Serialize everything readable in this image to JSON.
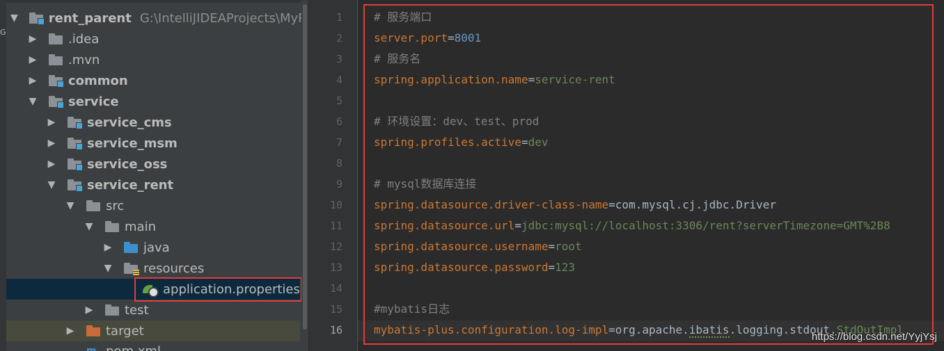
{
  "tree": {
    "strip_glyph": "G",
    "rows": [
      {
        "label": "rent_parent",
        "path": "G:\\IntelliJIDEAProjects\\MyProje"
      },
      {
        "label": ".idea"
      },
      {
        "label": ".mvn"
      },
      {
        "label": "common"
      },
      {
        "label": "service"
      },
      {
        "label": "service_cms"
      },
      {
        "label": "service_msm"
      },
      {
        "label": "service_oss"
      },
      {
        "label": "service_rent"
      },
      {
        "label": "src"
      },
      {
        "label": "main"
      },
      {
        "label": "java"
      },
      {
        "label": "resources"
      },
      {
        "label": "application.properties"
      },
      {
        "label": "test"
      },
      {
        "label": "target"
      },
      {
        "label": "pom.xml"
      }
    ]
  },
  "editor": {
    "line_numbers": [
      "1",
      "2",
      "3",
      "4",
      "5",
      "6",
      "7",
      "8",
      "9",
      "10",
      "11",
      "12",
      "13",
      "14",
      "15",
      "16"
    ],
    "current_line": "16",
    "lines": [
      {
        "comment": "# 服务端口"
      },
      {
        "key": "server.port",
        "eq": "=",
        "value": "8001"
      },
      {
        "comment": "# 服务名"
      },
      {
        "key": "spring.application.name",
        "eq": "=",
        "value": "service-rent"
      },
      {},
      {
        "comment": "# 环境设置：dev、test、prod"
      },
      {
        "key": "spring.profiles.active",
        "eq": "=",
        "value": "dev"
      },
      {},
      {
        "comment": "# mysql数据库连接"
      },
      {
        "key": "spring.datasource.driver-class-name",
        "eq": "=",
        "value": "com.mysql.cj.jdbc.Driver"
      },
      {
        "key": "spring.datasource.url",
        "eq": "=",
        "value": "jdbc:mysql://localhost:3306/rent?serverTimezone=GMT%2B8"
      },
      {
        "key": "spring.datasource.username",
        "eq": "=",
        "value": "root"
      },
      {
        "key": "spring.datasource.password",
        "eq": "=",
        "value": "123"
      },
      {},
      {
        "comment": "#mybatis日志"
      },
      {
        "key": "mybatis-plus.configuration.log-impl",
        "eq": "=",
        "value_a": "org.apache.",
        "value_b": "ibatis",
        "value_c": ".logging.stdout.",
        "value_d": "StdOutImpl"
      }
    ]
  },
  "watermark": "https://blog.csdn.net/YyjYsj",
  "colors": {
    "highlight_border": "#e03d3d",
    "selection": "#0d293e"
  }
}
